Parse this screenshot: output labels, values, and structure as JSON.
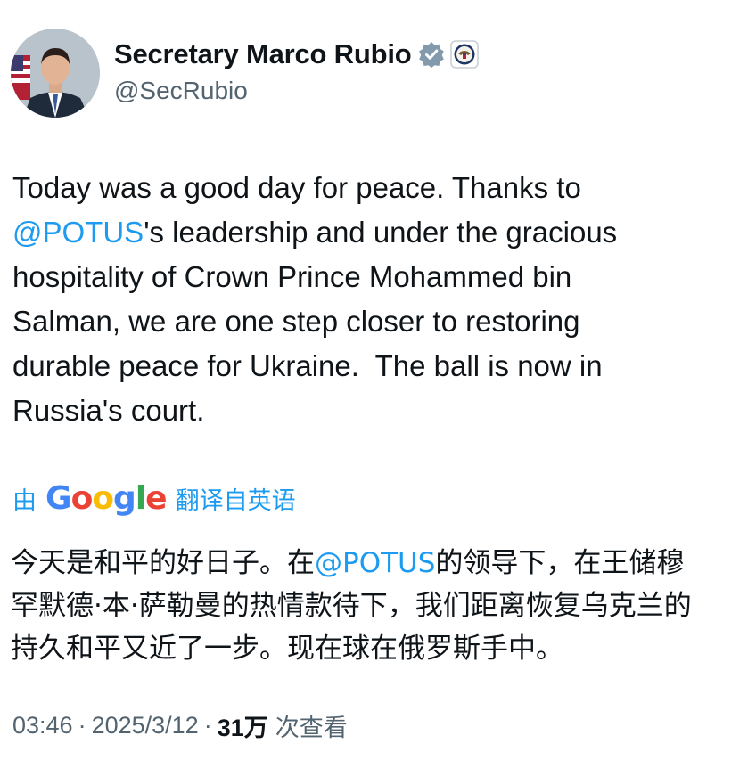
{
  "author": {
    "display_name": "Secretary Marco Rubio",
    "handle": "@SecRubio",
    "verified_badge_icon": "verified-badge-icon",
    "affiliation_icon": "state-department-seal-icon",
    "badge_color": "#829aab"
  },
  "tweet": {
    "line1": "Today was a good day for peace. Thanks to",
    "mention1": "@POTUS",
    "line2_rest": "'s leadership and under the gracious",
    "line3": "hospitality of Crown Prince Mohammed bin",
    "line4": "Salman, we are one step closer to restoring",
    "line5": "durable peace for Ukraine.  The ball is now in",
    "line6": "Russia's court."
  },
  "translation": {
    "prefix": "由",
    "provider_parts": [
      "G",
      "o",
      "o",
      "g",
      "l",
      "e"
    ],
    "suffix": "翻译自英语",
    "line1_before": "今天是和平的好日子。在",
    "mention": "@POTUS",
    "line1_after": "的领导下，在王储穆",
    "line2": "罕默德·本·萨勒曼的热情款待下，我们距离恢复乌克兰的",
    "line3": "持久和平又近了一步。现在球在俄罗斯手中。"
  },
  "meta": {
    "time": "03:46",
    "separator": "·",
    "date": "2025/3/12",
    "views_count": "31万",
    "views_label": "次查看"
  },
  "colors": {
    "link": "#1d9bf0",
    "text": "#0f1419",
    "secondary": "#536471"
  }
}
